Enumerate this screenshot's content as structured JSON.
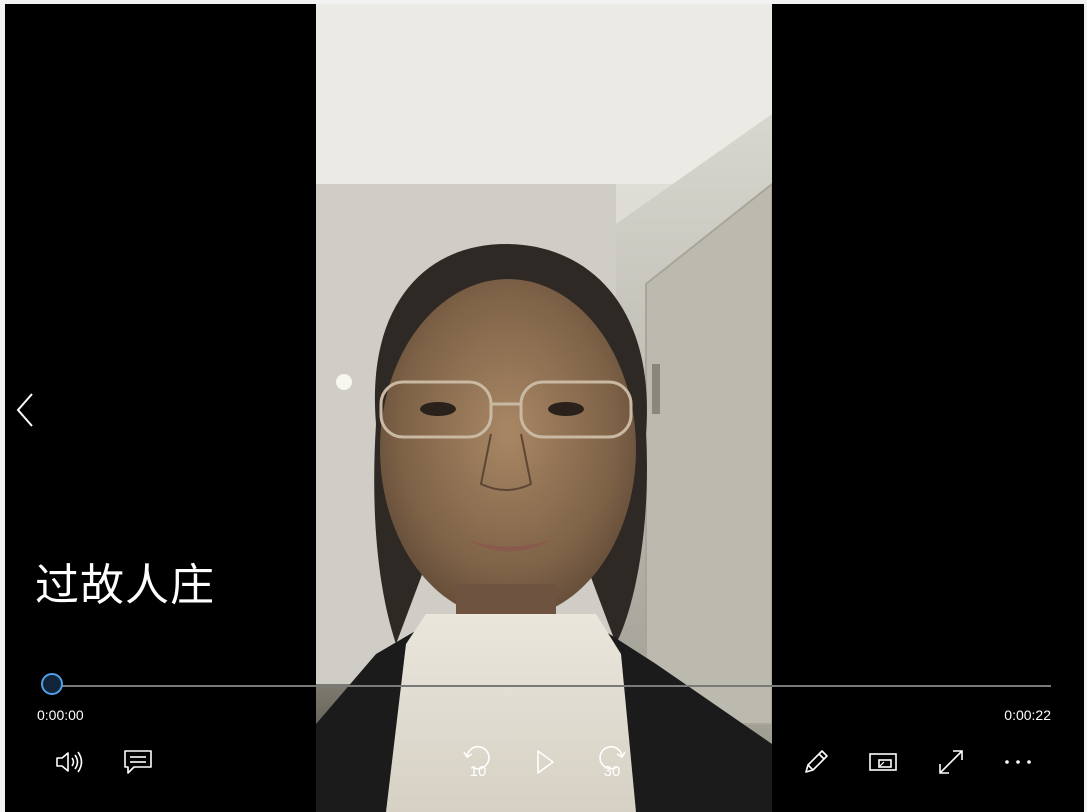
{
  "player": {
    "title": "过故人庄",
    "elapsed": "0:00:00",
    "duration": "0:00:22",
    "progress": 0.0,
    "accent_color": "#4ea0e8"
  },
  "controls": {
    "left": [
      {
        "name": "volume",
        "icon": "speaker-icon"
      },
      {
        "name": "subtitles",
        "icon": "captions-icon"
      }
    ],
    "center": [
      {
        "name": "skip-back",
        "icon": "rewind-icon",
        "label": "10"
      },
      {
        "name": "play",
        "icon": "play-icon"
      },
      {
        "name": "skip-forward",
        "icon": "forward-icon",
        "label": "30"
      }
    ],
    "right": [
      {
        "name": "edit",
        "icon": "pencil-icon"
      },
      {
        "name": "mini-view",
        "icon": "mini-view-icon"
      },
      {
        "name": "fullscreen",
        "icon": "expand-icon"
      },
      {
        "name": "more",
        "icon": "more-icon"
      }
    ]
  },
  "navigation": {
    "previous_icon": "chevron-left-icon"
  }
}
